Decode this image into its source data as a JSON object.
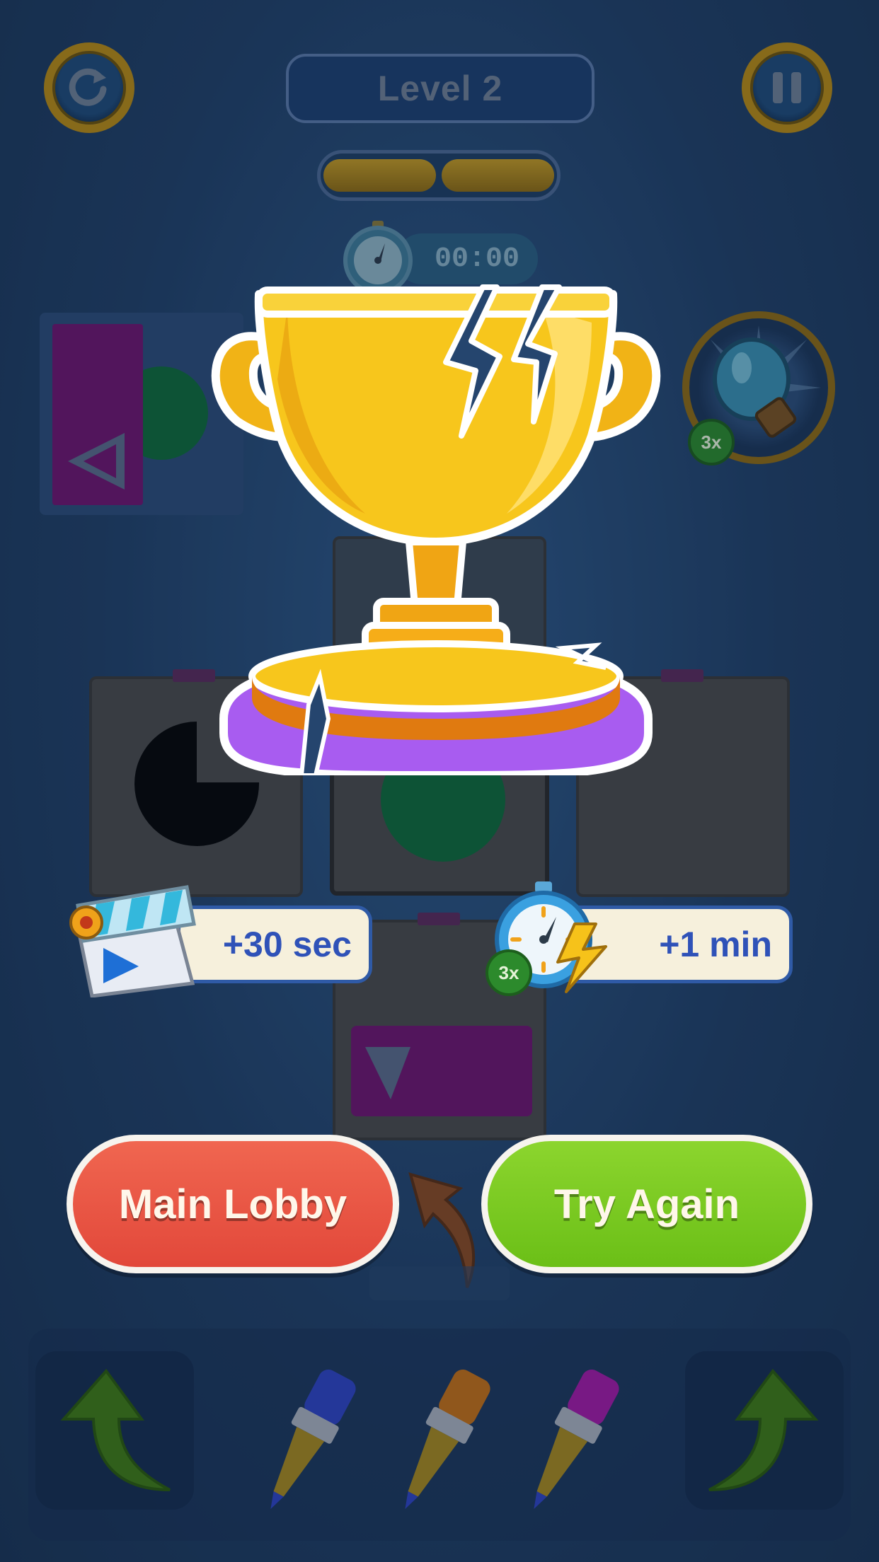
{
  "header": {
    "level_label": "Level 2"
  },
  "timer": {
    "value": "00:00"
  },
  "hint": {
    "multiplier": "3x"
  },
  "rewards": {
    "video": {
      "label": "+30 sec"
    },
    "time": {
      "label": "+1 min",
      "multiplier": "3x"
    }
  },
  "buttons": {
    "main_lobby": "Main Lobby",
    "try_again": "Try Again"
  },
  "brushes": [
    {
      "color": "#2f43c2"
    },
    {
      "color": "#c46f16"
    },
    {
      "color": "#a31aa6"
    }
  ],
  "colors": {
    "purple_piece": "#7a137a",
    "green_piece": "#0f7a3c",
    "trophy_gold": "#f4c21b",
    "trophy_base_purple": "#a85cf0",
    "button_red": "#e8523f",
    "button_green": "#7cca22"
  },
  "progress": {
    "segments_filled": 2,
    "segments_total": 2
  }
}
